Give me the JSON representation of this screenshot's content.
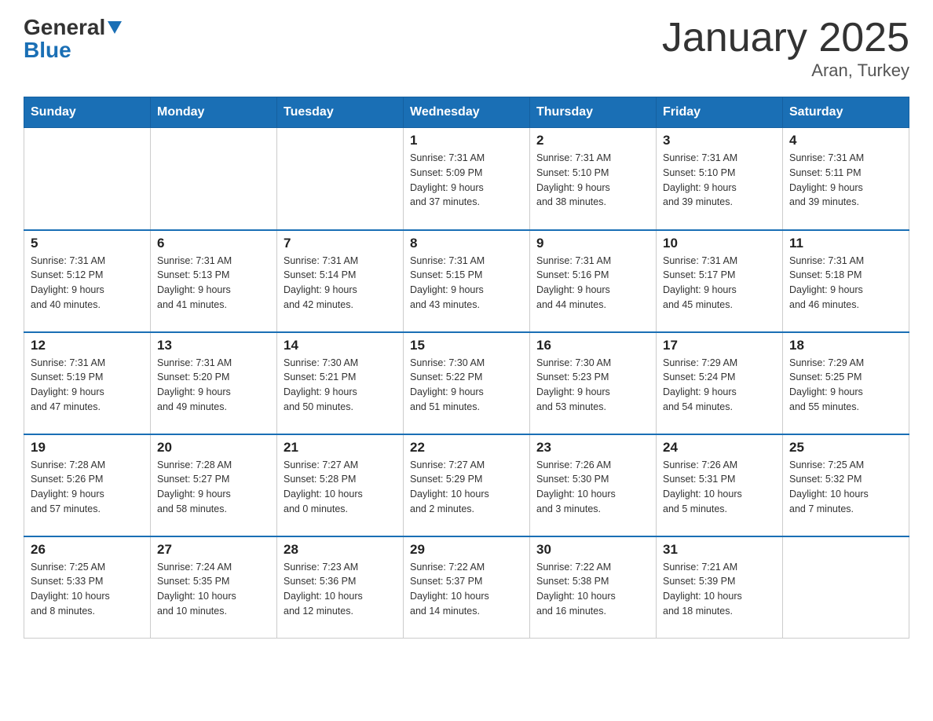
{
  "logo": {
    "general": "General",
    "triangle": "",
    "blue": "Blue"
  },
  "title": "January 2025",
  "subtitle": "Aran, Turkey",
  "days_of_week": [
    "Sunday",
    "Monday",
    "Tuesday",
    "Wednesday",
    "Thursday",
    "Friday",
    "Saturday"
  ],
  "weeks": [
    [
      {
        "day": "",
        "info": ""
      },
      {
        "day": "",
        "info": ""
      },
      {
        "day": "",
        "info": ""
      },
      {
        "day": "1",
        "info": "Sunrise: 7:31 AM\nSunset: 5:09 PM\nDaylight: 9 hours\nand 37 minutes."
      },
      {
        "day": "2",
        "info": "Sunrise: 7:31 AM\nSunset: 5:10 PM\nDaylight: 9 hours\nand 38 minutes."
      },
      {
        "day": "3",
        "info": "Sunrise: 7:31 AM\nSunset: 5:10 PM\nDaylight: 9 hours\nand 39 minutes."
      },
      {
        "day": "4",
        "info": "Sunrise: 7:31 AM\nSunset: 5:11 PM\nDaylight: 9 hours\nand 39 minutes."
      }
    ],
    [
      {
        "day": "5",
        "info": "Sunrise: 7:31 AM\nSunset: 5:12 PM\nDaylight: 9 hours\nand 40 minutes."
      },
      {
        "day": "6",
        "info": "Sunrise: 7:31 AM\nSunset: 5:13 PM\nDaylight: 9 hours\nand 41 minutes."
      },
      {
        "day": "7",
        "info": "Sunrise: 7:31 AM\nSunset: 5:14 PM\nDaylight: 9 hours\nand 42 minutes."
      },
      {
        "day": "8",
        "info": "Sunrise: 7:31 AM\nSunset: 5:15 PM\nDaylight: 9 hours\nand 43 minutes."
      },
      {
        "day": "9",
        "info": "Sunrise: 7:31 AM\nSunset: 5:16 PM\nDaylight: 9 hours\nand 44 minutes."
      },
      {
        "day": "10",
        "info": "Sunrise: 7:31 AM\nSunset: 5:17 PM\nDaylight: 9 hours\nand 45 minutes."
      },
      {
        "day": "11",
        "info": "Sunrise: 7:31 AM\nSunset: 5:18 PM\nDaylight: 9 hours\nand 46 minutes."
      }
    ],
    [
      {
        "day": "12",
        "info": "Sunrise: 7:31 AM\nSunset: 5:19 PM\nDaylight: 9 hours\nand 47 minutes."
      },
      {
        "day": "13",
        "info": "Sunrise: 7:31 AM\nSunset: 5:20 PM\nDaylight: 9 hours\nand 49 minutes."
      },
      {
        "day": "14",
        "info": "Sunrise: 7:30 AM\nSunset: 5:21 PM\nDaylight: 9 hours\nand 50 minutes."
      },
      {
        "day": "15",
        "info": "Sunrise: 7:30 AM\nSunset: 5:22 PM\nDaylight: 9 hours\nand 51 minutes."
      },
      {
        "day": "16",
        "info": "Sunrise: 7:30 AM\nSunset: 5:23 PM\nDaylight: 9 hours\nand 53 minutes."
      },
      {
        "day": "17",
        "info": "Sunrise: 7:29 AM\nSunset: 5:24 PM\nDaylight: 9 hours\nand 54 minutes."
      },
      {
        "day": "18",
        "info": "Sunrise: 7:29 AM\nSunset: 5:25 PM\nDaylight: 9 hours\nand 55 minutes."
      }
    ],
    [
      {
        "day": "19",
        "info": "Sunrise: 7:28 AM\nSunset: 5:26 PM\nDaylight: 9 hours\nand 57 minutes."
      },
      {
        "day": "20",
        "info": "Sunrise: 7:28 AM\nSunset: 5:27 PM\nDaylight: 9 hours\nand 58 minutes."
      },
      {
        "day": "21",
        "info": "Sunrise: 7:27 AM\nSunset: 5:28 PM\nDaylight: 10 hours\nand 0 minutes."
      },
      {
        "day": "22",
        "info": "Sunrise: 7:27 AM\nSunset: 5:29 PM\nDaylight: 10 hours\nand 2 minutes."
      },
      {
        "day": "23",
        "info": "Sunrise: 7:26 AM\nSunset: 5:30 PM\nDaylight: 10 hours\nand 3 minutes."
      },
      {
        "day": "24",
        "info": "Sunrise: 7:26 AM\nSunset: 5:31 PM\nDaylight: 10 hours\nand 5 minutes."
      },
      {
        "day": "25",
        "info": "Sunrise: 7:25 AM\nSunset: 5:32 PM\nDaylight: 10 hours\nand 7 minutes."
      }
    ],
    [
      {
        "day": "26",
        "info": "Sunrise: 7:25 AM\nSunset: 5:33 PM\nDaylight: 10 hours\nand 8 minutes."
      },
      {
        "day": "27",
        "info": "Sunrise: 7:24 AM\nSunset: 5:35 PM\nDaylight: 10 hours\nand 10 minutes."
      },
      {
        "day": "28",
        "info": "Sunrise: 7:23 AM\nSunset: 5:36 PM\nDaylight: 10 hours\nand 12 minutes."
      },
      {
        "day": "29",
        "info": "Sunrise: 7:22 AM\nSunset: 5:37 PM\nDaylight: 10 hours\nand 14 minutes."
      },
      {
        "day": "30",
        "info": "Sunrise: 7:22 AM\nSunset: 5:38 PM\nDaylight: 10 hours\nand 16 minutes."
      },
      {
        "day": "31",
        "info": "Sunrise: 7:21 AM\nSunset: 5:39 PM\nDaylight: 10 hours\nand 18 minutes."
      },
      {
        "day": "",
        "info": ""
      }
    ]
  ]
}
